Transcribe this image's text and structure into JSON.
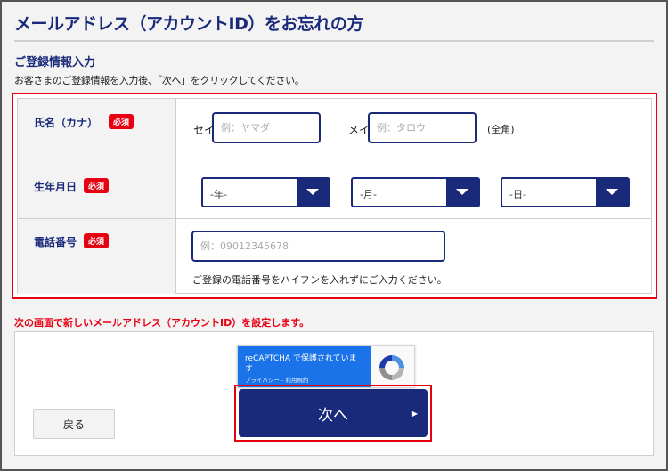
{
  "header": {
    "title": "メールアドレス（アカウントID）をお忘れの方"
  },
  "section": {
    "title": "ご登録情報入力",
    "instruction": "お客さまのご登録情報を入力後、「次へ」をクリックしてください。"
  },
  "form": {
    "required_badge": "必須",
    "name": {
      "label": "氏名（カナ）",
      "sei_label": "セイ",
      "sei_placeholder": "例：ヤマダ",
      "mei_label": "メイ",
      "mei_placeholder": "例：タロウ",
      "width_note": "(全角)"
    },
    "birthdate": {
      "label": "生年月日",
      "year_value": "-年-",
      "month_value": "-月-",
      "day_value": "-日-"
    },
    "phone": {
      "label": "電話番号",
      "placeholder": "例：09012345678",
      "help": "ご登録の電話番号をハイフンを入れずにご入力ください。"
    }
  },
  "notice": "次の画面で新しいメールアドレス（アカウントID）を設定します。",
  "recaptcha": {
    "line1": "reCAPTCHA で保護されていま",
    "line2": "す",
    "links": "プライバシー - 利用規約"
  },
  "buttons": {
    "next_label": "次へ",
    "back_label": "戻る"
  },
  "colors": {
    "accent_navy": "#1a2a7a",
    "required_red": "#e60012",
    "recaptcha_blue": "#1a73e8"
  }
}
